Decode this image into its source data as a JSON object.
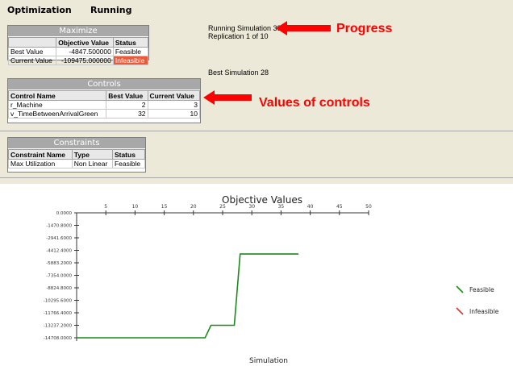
{
  "header": {
    "title": "Optimization",
    "state": "Running"
  },
  "maximize": {
    "title": "Maximize",
    "columns": [
      "",
      "Objective Value",
      "Status"
    ],
    "rows": [
      [
        "Best Value",
        "-4847.500000",
        "Feasible"
      ],
      [
        "Current Value",
        "-109475.000000",
        "Infeasible"
      ]
    ]
  },
  "controls": {
    "title": "Controls",
    "columns": [
      "Control Name",
      "Best Value",
      "Current Value"
    ],
    "rows": [
      [
        "r_Machine",
        "2",
        "3"
      ],
      [
        "v_TimeBetweenArrivalGreen",
        "32",
        "10"
      ]
    ]
  },
  "constraints": {
    "title": "Constraints",
    "columns": [
      "Constraint Name",
      "Type",
      "Status"
    ],
    "rows": [
      [
        "Max Utilization",
        "Non Linear",
        "Feasible"
      ]
    ]
  },
  "status": {
    "running_simulation": "Running Simulation  39",
    "replication": "Replication 1 of 10",
    "best_simulation": "Best Simulation 28"
  },
  "annotations": {
    "progress": "Progress",
    "controls": "Values of controls",
    "arrow_color": "#ff0000"
  },
  "chart_data": {
    "type": "line",
    "title": "Objective Values",
    "xlabel": "Simulation",
    "ylabel": "",
    "x_ticks": [
      5,
      10,
      15,
      20,
      25,
      30,
      35,
      40,
      45,
      50
    ],
    "y_ticks": [
      "0.0000",
      "-1470.8000",
      "-2941.6000",
      "-4412.4000",
      "-5883.2000",
      "-7354.0000",
      "-8824.8000",
      "-10295.6000",
      "-11766.4000",
      "-13237.2000",
      "-14708.0000"
    ],
    "xlim": [
      0,
      50
    ],
    "ylim": [
      -14708,
      0
    ],
    "legend_position": "right",
    "series": [
      {
        "name": "Feasible",
        "color": "#1a8a1a",
        "x": [
          0,
          22,
          23,
          27,
          28,
          38
        ],
        "y": [
          -14708,
          -14708,
          -13237.2,
          -13237.2,
          -4847.5,
          -4847.5
        ]
      },
      {
        "name": "Infeasible",
        "color": "#e03030",
        "x": [],
        "y": []
      }
    ]
  }
}
